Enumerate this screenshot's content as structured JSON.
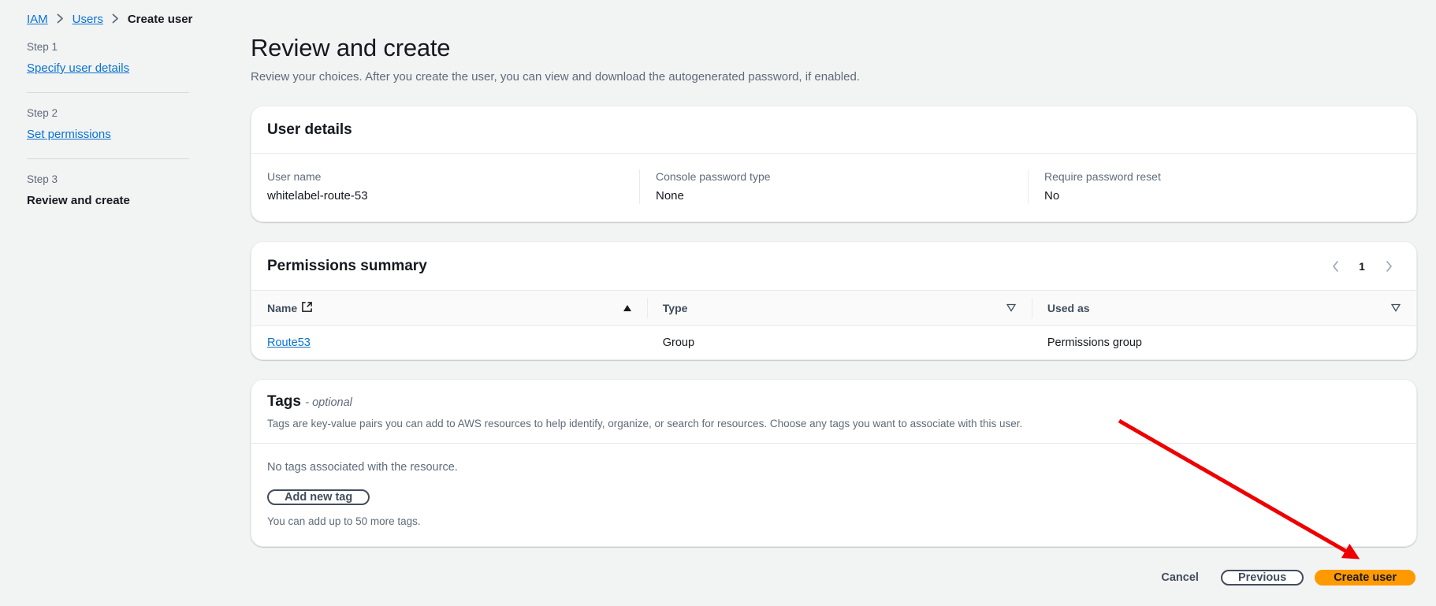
{
  "breadcrumb": {
    "items": [
      {
        "label": "IAM",
        "link": true
      },
      {
        "label": "Users",
        "link": true
      },
      {
        "label": "Create user",
        "link": false
      }
    ]
  },
  "sidebar": {
    "steps": [
      {
        "number": "Step 1",
        "label": "Specify user details",
        "current": false
      },
      {
        "number": "Step 2",
        "label": "Set permissions",
        "current": false
      },
      {
        "number": "Step 3",
        "label": "Review and create",
        "current": true
      }
    ]
  },
  "page": {
    "title": "Review and create",
    "description": "Review your choices. After you create the user, you can view and download the autogenerated password, if enabled."
  },
  "user_details": {
    "title": "User details",
    "fields": [
      {
        "label": "User name",
        "value": "whitelabel-route-53"
      },
      {
        "label": "Console password type",
        "value": "None"
      },
      {
        "label": "Require password reset",
        "value": "No"
      }
    ]
  },
  "permissions_summary": {
    "title": "Permissions summary",
    "pagination": {
      "page": "1",
      "prev_icon": "chevron-left-icon",
      "next_icon": "chevron-right-icon"
    },
    "columns": [
      {
        "label": "Name",
        "sort": "asc",
        "external_link_icon": true
      },
      {
        "label": "Type",
        "sort": "none",
        "external_link_icon": false
      },
      {
        "label": "Used as",
        "sort": "none",
        "external_link_icon": false
      }
    ],
    "rows": [
      {
        "name": "Route53",
        "type": "Group",
        "used_as": "Permissions group"
      }
    ]
  },
  "tags": {
    "title": "Tags",
    "optional_label": "- optional",
    "description": "Tags are key-value pairs you can add to AWS resources to help identify, organize, or search for resources. Choose any tags you want to associate with this user.",
    "empty_message": "No tags associated with the resource.",
    "add_button": "Add new tag",
    "hint": "You can add up to 50 more tags."
  },
  "footer": {
    "cancel": "Cancel",
    "previous": "Previous",
    "create": "Create user"
  },
  "colors": {
    "accent_link": "#0972d3",
    "primary_button": "#ff9900",
    "annotation_arrow": "#ee0000",
    "page_background": "#f2f3f3"
  }
}
